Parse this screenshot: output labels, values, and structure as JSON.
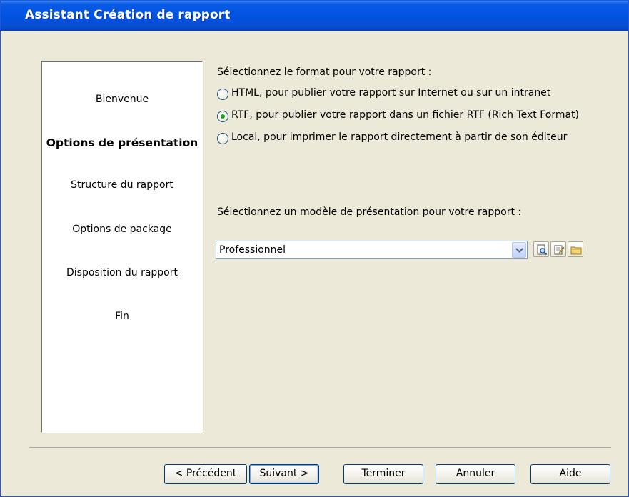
{
  "window": {
    "title": "Assistant Création de rapport"
  },
  "sidebar": {
    "steps": [
      {
        "label": "Bienvenue",
        "current": false
      },
      {
        "label": "Options de présentation",
        "current": true
      },
      {
        "label": "Structure du rapport",
        "current": false
      },
      {
        "label": "Options de package",
        "current": false
      },
      {
        "label": "Disposition du rapport",
        "current": false
      },
      {
        "label": "Fin",
        "current": false
      }
    ]
  },
  "format": {
    "prompt": "Sélectionnez le format pour votre rapport :",
    "options": [
      {
        "label": "HTML, pour publier votre rapport sur Internet ou sur un intranet",
        "checked": false
      },
      {
        "label": "RTF, pour publier votre rapport dans un fichier RTF (Rich Text Format)",
        "checked": true
      },
      {
        "label": "Local, pour imprimer le rapport directement à partir de son éditeur",
        "checked": false
      }
    ]
  },
  "template": {
    "prompt": "Sélectionnez un modèle de présentation pour votre rapport :",
    "selected": "Professionnel",
    "icons": [
      "preview-icon",
      "edit-icon",
      "folder-icon"
    ]
  },
  "buttons": {
    "previous": "< Précédent",
    "next": "Suivant >",
    "finish": "Terminer",
    "cancel": "Annuler",
    "help": "Aide"
  },
  "colors": {
    "titlebar": "#0052e0",
    "dialog": "#ece9d8",
    "radio_checked": "#21a121"
  }
}
